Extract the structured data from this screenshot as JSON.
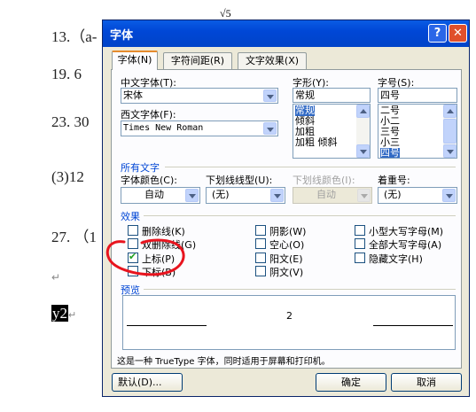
{
  "background_doc": {
    "top_fragment": "√5",
    "lines": [
      {
        "text": "13.（a-"
      },
      {
        "text": "19. 6"
      },
      {
        "text": "23.  30"
      },
      {
        "text": "(3)12"
      },
      {
        "text": "27.   （1"
      },
      {
        "text": "y2"
      }
    ],
    "para_mark": "↵"
  },
  "dialog": {
    "title": "字体",
    "help_label": "?",
    "close_label": "✕",
    "tabs": [
      {
        "label": "字体(N)"
      },
      {
        "label": "字符间距(R)"
      },
      {
        "label": "文字效果(X)"
      }
    ],
    "chinese_font": {
      "label": "中文字体(T):",
      "value": "宋体"
    },
    "western_font": {
      "label": "西文字体(F):",
      "value": "Times New Roman"
    },
    "style": {
      "label": "字形(Y):",
      "value": "常规",
      "options": [
        "常规",
        "倾斜",
        "加粗",
        "加粗 倾斜"
      ],
      "selected": "常规"
    },
    "size": {
      "label": "字号(S):",
      "value": "四号",
      "options": [
        "二号",
        "小二",
        "三号",
        "小三",
        "四号"
      ],
      "selected": "四号"
    },
    "all_text": {
      "heading": "所有文字",
      "font_color": {
        "label": "字体颜色(C):",
        "value": "自动"
      },
      "underline_style": {
        "label": "下划线线型(U):",
        "value": "(无)"
      },
      "underline_color": {
        "label": "下划线颜色(I):",
        "value": "自动"
      },
      "emphasis": {
        "label": "着重号:",
        "value": "(无)"
      }
    },
    "effects": {
      "heading": "效果",
      "items": [
        {
          "label": "删除线(K)",
          "checked": false
        },
        {
          "label": "双删除线(G)",
          "checked": false
        },
        {
          "label": "上标(P)",
          "checked": true
        },
        {
          "label": "下标(B)",
          "checked": false
        },
        {
          "label": "阴影(W)",
          "checked": false
        },
        {
          "label": "空心(O)",
          "checked": false
        },
        {
          "label": "阳文(E)",
          "checked": false
        },
        {
          "label": "阴文(V)",
          "checked": false
        },
        {
          "label": "小型大写字母(M)",
          "checked": false
        },
        {
          "label": "全部大写字母(A)",
          "checked": false
        },
        {
          "label": "隐藏文字(H)",
          "checked": false
        }
      ]
    },
    "preview": {
      "heading": "预览",
      "sample": "2"
    },
    "description": "这是一种 TrueType 字体，同时适用于屏幕和打印机。",
    "buttons": {
      "default": "默认(D)...",
      "ok": "确定",
      "cancel": "取消"
    },
    "colors": {
      "title_bar": "#0054e3",
      "dialog_bg": "#ece9d8",
      "annotation": "#e8141e",
      "selection": "#316ac5"
    }
  }
}
